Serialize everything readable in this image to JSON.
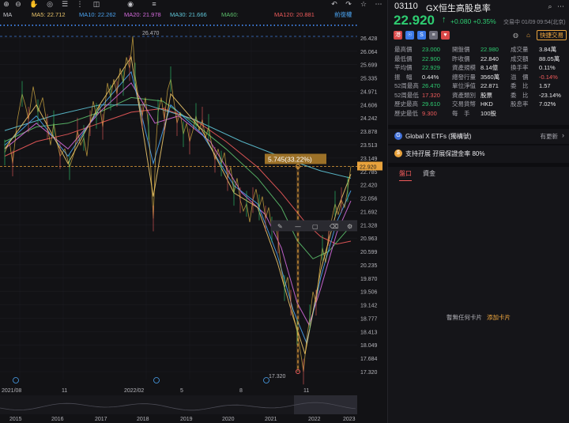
{
  "toolbar": {
    "left_icons": [
      "tb-zoom-in-icon",
      "tb-zoom-out-icon",
      "tb-hand-icon",
      "tb-target-icon",
      "tb-menu-icon",
      "tb-dots-icon",
      "tb-camera-icon",
      "tb-eye-icon",
      "tb-list-icon"
    ],
    "right_icons": [
      "undo-icon",
      "redo-icon",
      "star-icon",
      "more-icon"
    ]
  },
  "legend": {
    "prefix": "MA",
    "items": [
      {
        "label": "MA5:",
        "value": "22.712",
        "color": "#e9c46a"
      },
      {
        "label": "MA10:",
        "value": "22.262",
        "color": "#4aa3f0"
      },
      {
        "label": "MA20:",
        "value": "21.978",
        "color": "#d36adb"
      },
      {
        "label": "MA30:",
        "value": "21.666",
        "color": "#5fc6d8"
      },
      {
        "label": "MA60:",
        "value": "",
        "color": "#5cbf6b"
      },
      {
        "label": "MA120:",
        "value": "20.881",
        "color": "#ef5b5b"
      }
    ],
    "adjust_label": "前復權"
  },
  "chart_data": {
    "type": "line",
    "title": "",
    "xlabel": "",
    "ylabel": "",
    "y_ticks": [
      "26.428",
      "26.064",
      "25.699",
      "25.335",
      "24.971",
      "24.606",
      "24.242",
      "23.878",
      "23.513",
      "23.149",
      "22.785",
      "22.420",
      "22.056",
      "21.692",
      "21.328",
      "20.963",
      "20.599",
      "20.235",
      "19.870",
      "19.506",
      "19.142",
      "18.777",
      "18.413",
      "18.049",
      "17.684",
      "17.320"
    ],
    "top_time_labels": [
      "2021/08",
      "11",
      "2022/02",
      "5",
      "8",
      "11"
    ],
    "bottom_year_labels": [
      "2015",
      "2016",
      "2017",
      "2018",
      "2019",
      "2020",
      "2021",
      "2022",
      "2023"
    ],
    "ylim": [
      17.32,
      26.47
    ],
    "high_label": "26.470",
    "low_label": "17.320",
    "current_price": "22.920",
    "measure_label": "5.745(33.22%)",
    "price_series": [
      [
        0,
        23.3
      ],
      [
        6,
        23.6
      ],
      [
        10,
        23.0
      ],
      [
        16,
        24.2
      ],
      [
        22,
        24.9
      ],
      [
        26,
        24.6
      ],
      [
        30,
        24.2
      ],
      [
        36,
        25.1
      ],
      [
        42,
        24.4
      ],
      [
        48,
        24.8
      ],
      [
        54,
        24.0
      ],
      [
        58,
        23.5
      ],
      [
        62,
        24.1
      ],
      [
        66,
        23.6
      ],
      [
        70,
        23.2
      ],
      [
        76,
        23.4
      ],
      [
        82,
        22.9
      ],
      [
        88,
        23.3
      ],
      [
        92,
        23.9
      ],
      [
        96,
        23.5
      ],
      [
        100,
        23.7
      ],
      [
        104,
        23.2
      ],
      [
        108,
        24.1
      ],
      [
        112,
        24.7
      ],
      [
        116,
        24.3
      ],
      [
        120,
        24.6
      ],
      [
        124,
        24.0
      ],
      [
        130,
        25.2
      ],
      [
        134,
        24.8
      ],
      [
        138,
        25.3
      ],
      [
        142,
        24.9
      ],
      [
        146,
        25.6
      ],
      [
        150,
        25.2
      ],
      [
        154,
        25.9
      ],
      [
        158,
        25.6
      ],
      [
        162,
        26.47
      ],
      [
        165,
        25.4
      ],
      [
        170,
        24.7
      ],
      [
        174,
        24.3
      ],
      [
        178,
        24.8
      ],
      [
        182,
        24.0
      ],
      [
        185,
        22.8
      ],
      [
        188,
        21.5
      ],
      [
        191,
        23.4
      ],
      [
        194,
        24.4
      ],
      [
        198,
        24.8
      ],
      [
        202,
        24.2
      ],
      [
        206,
        25.0
      ],
      [
        210,
        25.3
      ],
      [
        214,
        24.7
      ],
      [
        218,
        24.1
      ],
      [
        222,
        24.4
      ],
      [
        226,
        23.8
      ],
      [
        230,
        24.1
      ],
      [
        234,
        23.6
      ],
      [
        238,
        23.9
      ],
      [
        242,
        24.3
      ],
      [
        246,
        23.9
      ],
      [
        250,
        24.2
      ],
      [
        254,
        23.7
      ],
      [
        258,
        24.0
      ],
      [
        262,
        23.5
      ],
      [
        266,
        23.1
      ],
      [
        270,
        23.4
      ],
      [
        274,
        23.0
      ],
      [
        278,
        23.3
      ],
      [
        282,
        22.6
      ],
      [
        286,
        22.9
      ],
      [
        290,
        22.2
      ],
      [
        294,
        22.6
      ],
      [
        298,
        22.0
      ],
      [
        302,
        21.7
      ],
      [
        306,
        21.9
      ],
      [
        310,
        21.4
      ],
      [
        314,
        22.0
      ],
      [
        318,
        22.3
      ],
      [
        322,
        21.8
      ],
      [
        326,
        22.1
      ],
      [
        330,
        21.5
      ],
      [
        334,
        21.8
      ],
      [
        338,
        21.2
      ],
      [
        342,
        21.4
      ],
      [
        346,
        20.9
      ],
      [
        350,
        20.1
      ],
      [
        354,
        19.6
      ],
      [
        358,
        19.9
      ],
      [
        362,
        19.2
      ],
      [
        366,
        18.8
      ],
      [
        370,
        18.4
      ],
      [
        374,
        17.9
      ],
      [
        378,
        17.32
      ],
      [
        382,
        18.2
      ],
      [
        386,
        18.8
      ],
      [
        390,
        19.5
      ],
      [
        394,
        19.2
      ],
      [
        398,
        20.0
      ],
      [
        402,
        20.7
      ],
      [
        406,
        20.3
      ],
      [
        410,
        21.1
      ],
      [
        414,
        21.5
      ],
      [
        418,
        21.9
      ],
      [
        422,
        21.6
      ],
      [
        426,
        22.0
      ],
      [
        430,
        21.8
      ],
      [
        434,
        22.3
      ],
      [
        438,
        22.92
      ]
    ],
    "ma_series": [
      {
        "name": "MA120",
        "color": "#ef5b5b",
        "points": [
          [
            0,
            23.2
          ],
          [
            40,
            23.6
          ],
          [
            80,
            23.8
          ],
          [
            120,
            24.1
          ],
          [
            160,
            24.4
          ],
          [
            200,
            24.5
          ],
          [
            240,
            24.2
          ],
          [
            280,
            23.6
          ],
          [
            320,
            22.9
          ],
          [
            350,
            22.2
          ],
          [
            380,
            21.4
          ],
          [
            400,
            21.0
          ],
          [
            420,
            20.8
          ],
          [
            438,
            20.88
          ]
        ]
      },
      {
        "name": "MA60",
        "color": "#5cbf6b",
        "points": [
          [
            0,
            23.6
          ],
          [
            40,
            24.0
          ],
          [
            80,
            24.1
          ],
          [
            120,
            24.4
          ],
          [
            160,
            24.8
          ],
          [
            200,
            24.7
          ],
          [
            240,
            24.1
          ],
          [
            280,
            23.4
          ],
          [
            320,
            22.6
          ],
          [
            350,
            21.8
          ],
          [
            370,
            20.9
          ],
          [
            390,
            20.4
          ],
          [
            410,
            20.6
          ],
          [
            438,
            21.3
          ]
        ]
      },
      {
        "name": "MA30",
        "color": "#5fc6d8",
        "points": [
          [
            0,
            23.9
          ],
          [
            60,
            24.3
          ],
          [
            120,
            24.6
          ],
          [
            180,
            24.6
          ],
          [
            240,
            24.2
          ],
          [
            300,
            23.6
          ],
          [
            360,
            23.1
          ],
          [
            400,
            22.8
          ],
          [
            438,
            22.6
          ]
        ]
      },
      {
        "name": "MA20",
        "color": "#d36adb",
        "points": [
          [
            0,
            23.4
          ],
          [
            40,
            24.1
          ],
          [
            80,
            23.4
          ],
          [
            120,
            24.4
          ],
          [
            160,
            25.2
          ],
          [
            190,
            24.1
          ],
          [
            220,
            24.3
          ],
          [
            260,
            23.6
          ],
          [
            300,
            22.2
          ],
          [
            330,
            21.6
          ],
          [
            350,
            20.7
          ],
          [
            370,
            19.2
          ],
          [
            385,
            18.6
          ],
          [
            400,
            19.6
          ],
          [
            420,
            21.1
          ],
          [
            438,
            21.98
          ]
        ]
      },
      {
        "name": "MA10",
        "color": "#4aa3f0",
        "points": [
          [
            0,
            23.5
          ],
          [
            40,
            24.3
          ],
          [
            80,
            23.2
          ],
          [
            120,
            24.5
          ],
          [
            160,
            25.5
          ],
          [
            188,
            23.0
          ],
          [
            210,
            24.6
          ],
          [
            250,
            23.8
          ],
          [
            290,
            22.4
          ],
          [
            320,
            21.9
          ],
          [
            345,
            20.5
          ],
          [
            365,
            19.0
          ],
          [
            382,
            18.1
          ],
          [
            400,
            19.9
          ],
          [
            420,
            21.4
          ],
          [
            438,
            22.26
          ]
        ]
      },
      {
        "name": "MA5",
        "color": "#e9c46a",
        "points": [
          [
            0,
            23.4
          ],
          [
            40,
            24.6
          ],
          [
            80,
            23.0
          ],
          [
            120,
            24.6
          ],
          [
            160,
            25.9
          ],
          [
            188,
            22.1
          ],
          [
            210,
            24.9
          ],
          [
            250,
            23.9
          ],
          [
            290,
            22.2
          ],
          [
            320,
            21.8
          ],
          [
            345,
            20.3
          ],
          [
            365,
            18.8
          ],
          [
            380,
            17.8
          ],
          [
            400,
            20.1
          ],
          [
            420,
            21.7
          ],
          [
            438,
            22.71
          ]
        ]
      }
    ]
  },
  "quote": {
    "code": "03110",
    "name": "GX恒生高股息率",
    "price": "22.920",
    "arrow": "↑",
    "change": "+0.080 +0.35%",
    "timestamp": "交易中 01/09 09:54(北京)",
    "quick_trade": "快捷交易",
    "badges": [
      {
        "name": "hk-badge-icon",
        "text": "港",
        "color": "#d94848"
      },
      {
        "name": "etf-badge-icon",
        "text": "☉",
        "color": "#3c7ae8"
      },
      {
        "name": "s-badge-icon",
        "text": "S",
        "color": "#3c7ae8"
      },
      {
        "name": "list-badge-icon",
        "text": "≡",
        "color": "#6b6b78"
      },
      {
        "name": "heart-badge-icon",
        "text": "♥",
        "color": "#d94848"
      }
    ]
  },
  "stats": {
    "col1": [
      {
        "label": "最高價",
        "value": "23.000",
        "color": "#2ecc71"
      },
      {
        "label": "最低價",
        "value": "22.900",
        "color": "#2ecc71"
      },
      {
        "label": "平均價",
        "value": "22.929",
        "color": "#2ecc71"
      },
      {
        "label": "振　幅",
        "value": "0.44%",
        "color": "#e8e8ea"
      },
      {
        "label": "52周最高",
        "value": "26.470",
        "color": "#2ecc71"
      },
      {
        "label": "52周最低",
        "value": "17.320",
        "color": "#ef5b5b"
      },
      {
        "label": "歷史最高",
        "value": "29.610",
        "color": "#2ecc71"
      },
      {
        "label": "歷史最低",
        "value": "9.300",
        "color": "#ef5b5b"
      }
    ],
    "col2": [
      {
        "label": "開盤價",
        "value": "22.980",
        "color": "#2ecc71"
      },
      {
        "label": "昨收價",
        "value": "22.840",
        "color": "#e8e8ea"
      },
      {
        "label": "資產規模",
        "value": "8.14億",
        "color": "#e8e8ea"
      },
      {
        "label": "總發行量",
        "value": "3560萬",
        "color": "#e8e8ea"
      },
      {
        "label": "單位淨值",
        "value": "22.871",
        "color": "#e8e8ea"
      },
      {
        "label": "資產類別",
        "value": "股票",
        "color": "#e8e8ea"
      },
      {
        "label": "交易貨幣",
        "value": "HKD",
        "color": "#e8e8ea"
      },
      {
        "label": "每　手",
        "value": "100股",
        "color": "#e8e8ea"
      }
    ],
    "col3": [
      {
        "label": "成交量",
        "value": "3.84萬",
        "color": "#e8e8ea"
      },
      {
        "label": "成交額",
        "value": "88.05萬",
        "color": "#e8e8ea"
      },
      {
        "label": "換手率",
        "value": "0.11%",
        "color": "#e8e8ea"
      },
      {
        "label": "溢　價",
        "value": "-0.14%",
        "color": "#ef5b5b"
      },
      {
        "label": "委　比",
        "value": "1.57",
        "color": "#e8e8ea"
      },
      {
        "label": "委　比",
        "value": "-23.14%",
        "color": "#e8e8ea"
      },
      {
        "label": "股息率",
        "value": "7.02%",
        "color": "#e8e8ea"
      }
    ]
  },
  "etf": {
    "label": "Global X ETFs (獨構號)",
    "more": "有更新"
  },
  "margin": {
    "label": "支持孖展 孖展保證金率 80%"
  },
  "tabs": [
    {
      "label": "盤口",
      "active": true
    },
    {
      "label": "資金",
      "active": false
    }
  ],
  "empty": {
    "text": "暫無任何卡片",
    "link": "添加卡片"
  }
}
